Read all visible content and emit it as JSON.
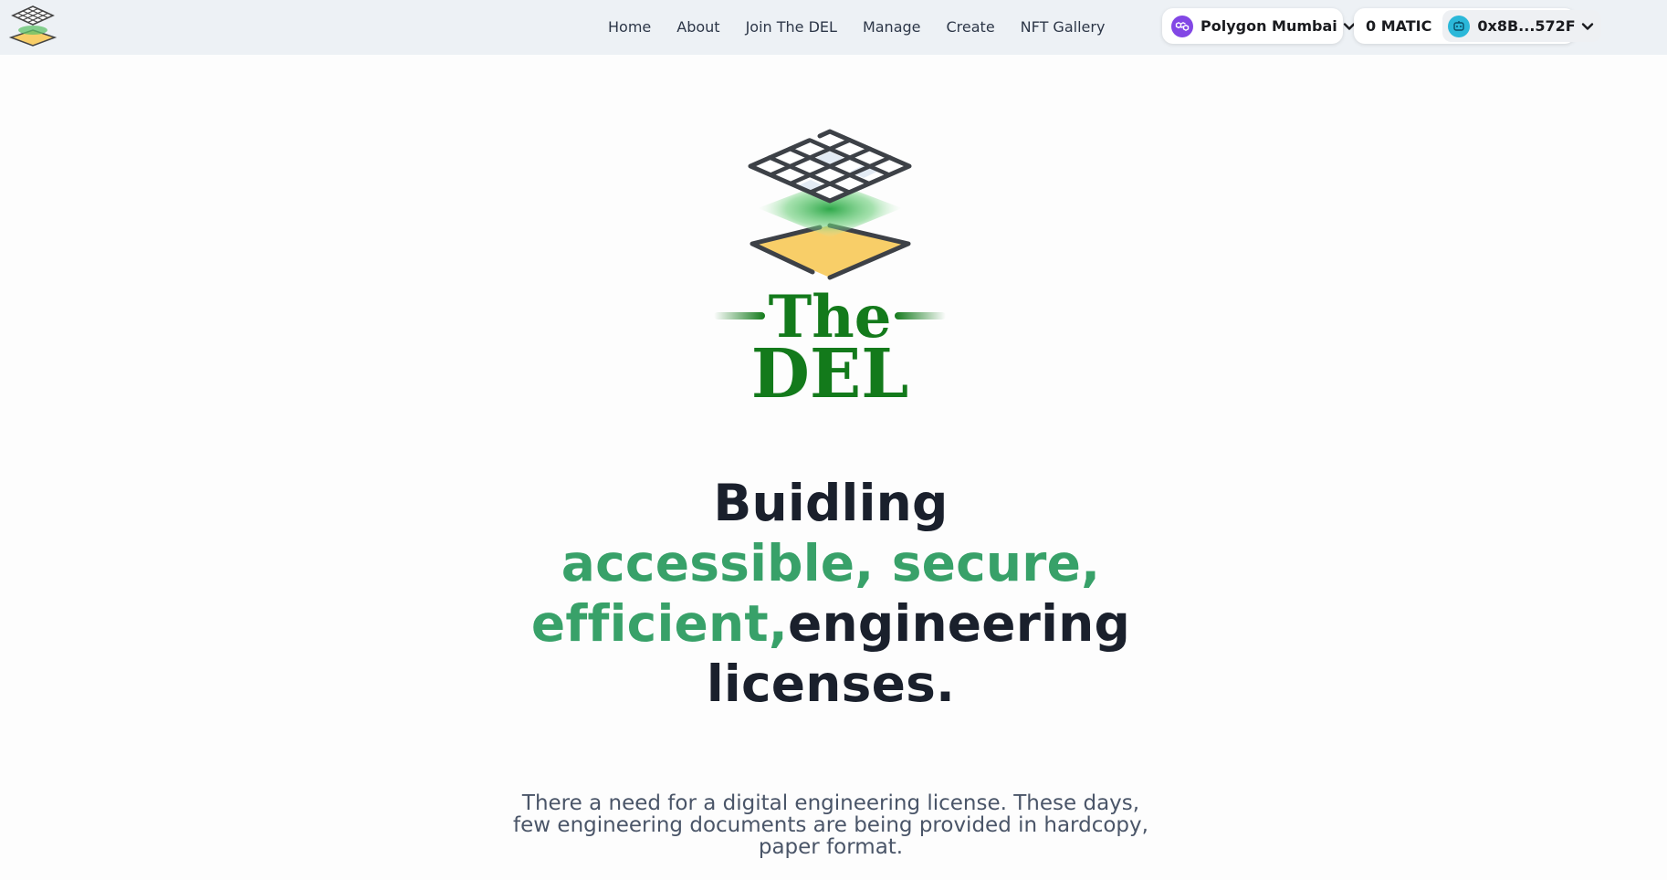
{
  "nav": {
    "links": [
      {
        "label": "Home"
      },
      {
        "label": "About"
      },
      {
        "label": "Join The DEL"
      },
      {
        "label": "Manage"
      },
      {
        "label": "Create"
      },
      {
        "label": "NFT Gallery"
      }
    ],
    "network": {
      "label": "Polygon Mumbai",
      "icon": "polygon-icon",
      "color": "#8247e5"
    },
    "account": {
      "balance": "0 MATIC",
      "address": "0x8B...572F",
      "avatar_icon": "avatar-icon"
    }
  },
  "hero": {
    "logo_text_top": "The",
    "logo_text_bottom": "DEL",
    "heading": {
      "line1": "Buidling",
      "line2_accent": "accessible, secure,",
      "line3_accent": "efficient,",
      "line3_rest": "engineering",
      "line4": "licenses."
    },
    "subtext": "There a need for a digital engineering license. These days, few engineering documents are being provided in hardcopy, paper format."
  },
  "colors": {
    "accent_green": "#38a169",
    "logo_green": "#137a1b",
    "logo_yellow": "#f8ce68",
    "navbar_bg": "#edf1f5"
  }
}
